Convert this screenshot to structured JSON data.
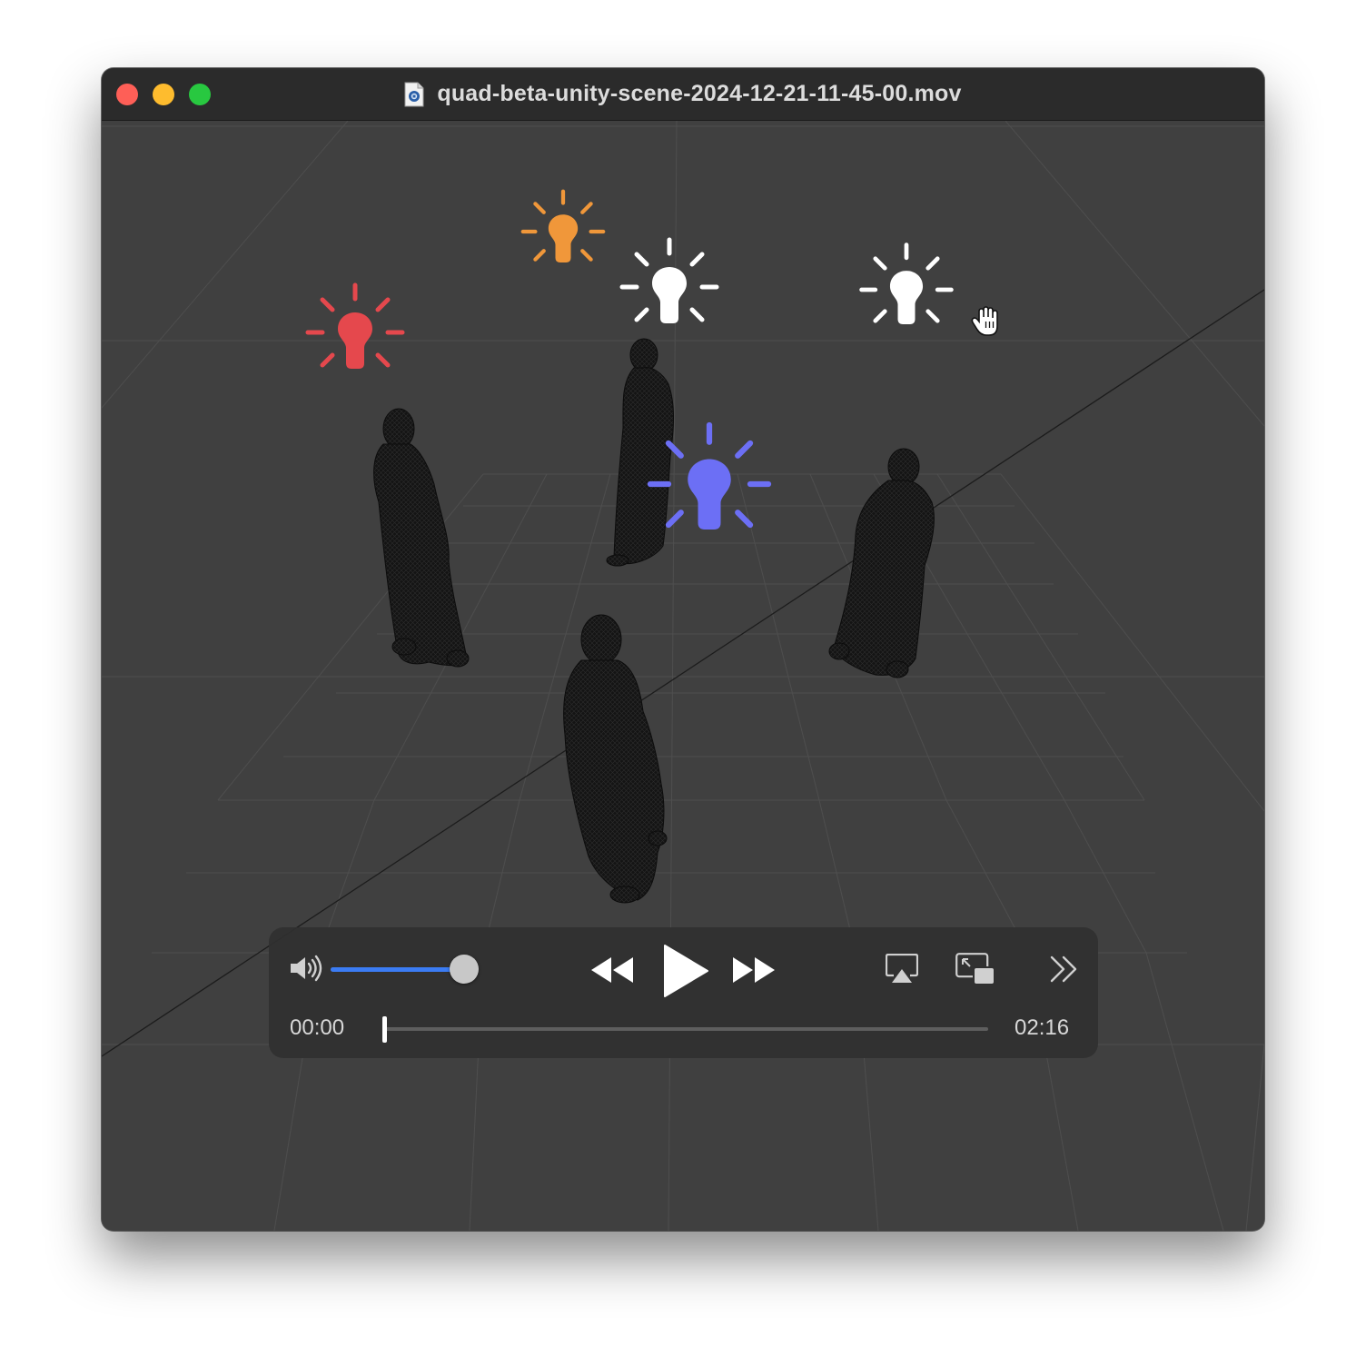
{
  "window": {
    "title": "quad-beta-unity-scene-2024-12-21-11-45-00.mov",
    "file_icon": "quicktime-document-icon"
  },
  "traffic_lights": {
    "close": "#fe5f57",
    "minimize": "#febc2e",
    "maximize": "#28c840"
  },
  "scene": {
    "background": "#404040",
    "lights": [
      {
        "name": "light-red",
        "color": "#e5484d"
      },
      {
        "name": "light-orange",
        "color": "#f0973a"
      },
      {
        "name": "light-white-center",
        "color": "#ffffff"
      },
      {
        "name": "light-white-right",
        "color": "#ffffff"
      },
      {
        "name": "light-blue",
        "color": "#6c6ff5"
      }
    ],
    "figures": [
      "robed-figure-left",
      "robed-figure-back",
      "robed-figure-right",
      "robed-figure-front"
    ],
    "cursor": "hand-cursor-icon"
  },
  "player": {
    "current_time": "00:00",
    "duration": "02:16",
    "playback_fraction": 0.0,
    "volume_fraction": 0.92,
    "accent_color": "#3b7cf4",
    "buttons": {
      "volume": "speaker-icon",
      "rewind": "rewind-icon",
      "play": "play-icon",
      "fast_forward": "fast-forward-icon",
      "airplay": "airplay-icon",
      "picture_in_picture": "picture-in-picture-icon",
      "more": "chevron-double-right-icon"
    }
  }
}
